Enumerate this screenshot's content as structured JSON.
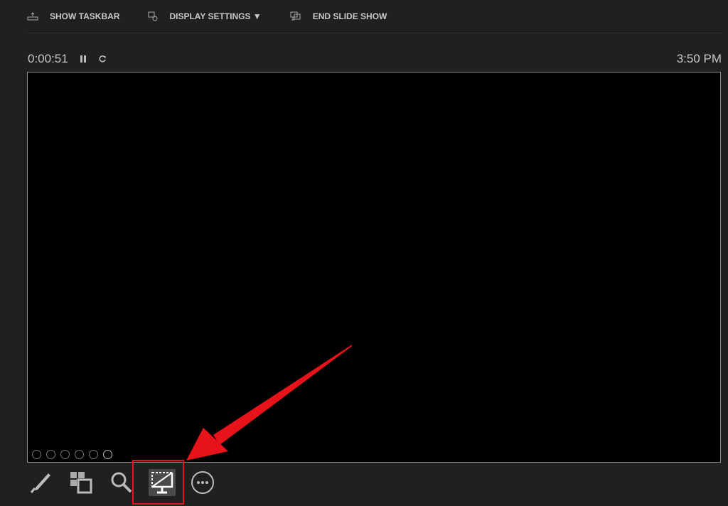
{
  "topbar": {
    "show_taskbar": "SHOW TASKBAR",
    "display_settings": "DISPLAY SETTINGS ▼",
    "end_slide_show": "END SLIDE SHOW"
  },
  "status": {
    "elapsed": "0:00:51",
    "clock": "3:50 PM"
  },
  "accent": "#e8121a"
}
